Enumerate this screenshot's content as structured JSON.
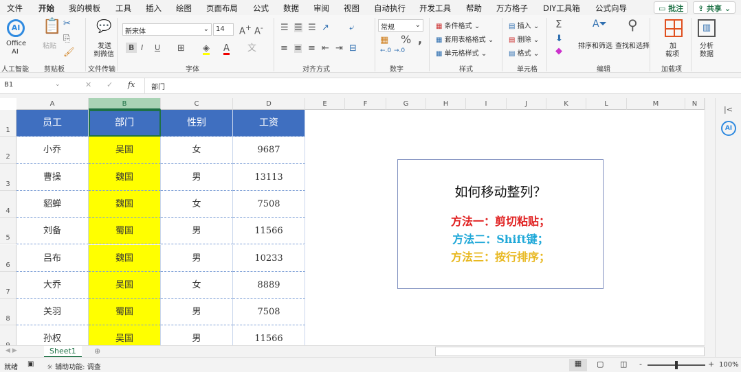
{
  "tabs": [
    "文件",
    "开始",
    "我的模板",
    "工具",
    "插入",
    "绘图",
    "页面布局",
    "公式",
    "数据",
    "审阅",
    "视图",
    "自动执行",
    "开发工具",
    "帮助",
    "万方格子",
    "DIY工具箱",
    "公式向导"
  ],
  "top_buttons": {
    "comment": "批注",
    "share": "共享"
  },
  "ribbon": {
    "ai": {
      "label1": "Office",
      "label2": "AI",
      "group": "人工智能"
    },
    "clipboard": {
      "paste": "粘贴",
      "group": "剪贴板"
    },
    "transfer": {
      "label1": "发送",
      "label2": "到微信",
      "group": "文件传输"
    },
    "font": {
      "name": "新宋体",
      "size": "14",
      "bold": "B",
      "italic": "I",
      "underline": "U",
      "group": "字体"
    },
    "align": {
      "group": "对齐方式"
    },
    "number": {
      "format": "常规",
      "group": "数字"
    },
    "styles": {
      "cond": "条件格式",
      "table": "套用表格格式",
      "cell": "单元格样式",
      "group": "样式"
    },
    "cells": {
      "insert": "插入",
      "delete": "删除",
      "format": "格式",
      "group": "单元格"
    },
    "edit": {
      "sort": "排序和筛选",
      "find": "查找和选择",
      "group": "编辑"
    },
    "addins": {
      "label1": "加",
      "label2": "载项",
      "group": "加载项"
    },
    "analyze": {
      "label1": "分析",
      "label2": "数据"
    }
  },
  "formula_bar": {
    "name_box": "B1",
    "fx": "fx",
    "value": "部门"
  },
  "columns": [
    "A",
    "B",
    "C",
    "D",
    "E",
    "F",
    "G",
    "H",
    "I",
    "J",
    "K",
    "L",
    "M",
    "N"
  ],
  "rows": [
    "1",
    "2",
    "3",
    "4",
    "5",
    "6",
    "7",
    "8",
    "9"
  ],
  "table": {
    "headers": [
      "员工",
      "部门",
      "性别",
      "工资"
    ],
    "data": [
      [
        "小乔",
        "吴国",
        "女",
        "9687"
      ],
      [
        "曹操",
        "魏国",
        "男",
        "13113"
      ],
      [
        "貂蝉",
        "魏国",
        "女",
        "7508"
      ],
      [
        "刘备",
        "蜀国",
        "男",
        "11566"
      ],
      [
        "吕布",
        "魏国",
        "男",
        "10233"
      ],
      [
        "大乔",
        "吴国",
        "女",
        "8889"
      ],
      [
        "关羽",
        "蜀国",
        "男",
        "7508"
      ],
      [
        "孙权",
        "吴国",
        "男",
        "11566"
      ]
    ]
  },
  "textbox": {
    "title": "如何移动整列？",
    "lines": [
      {
        "text": "方法一：剪切粘贴；",
        "color": "#e02020"
      },
      {
        "text": "方法二：Shift键；",
        "color": "#1fa8d8"
      },
      {
        "text": "方法三：按行排序；",
        "color": "#e8b820"
      }
    ]
  },
  "sheet_tab": "Sheet1",
  "status": {
    "ready": "就绪",
    "accessibility": "辅助功能: 调查",
    "zoom": "100%"
  }
}
